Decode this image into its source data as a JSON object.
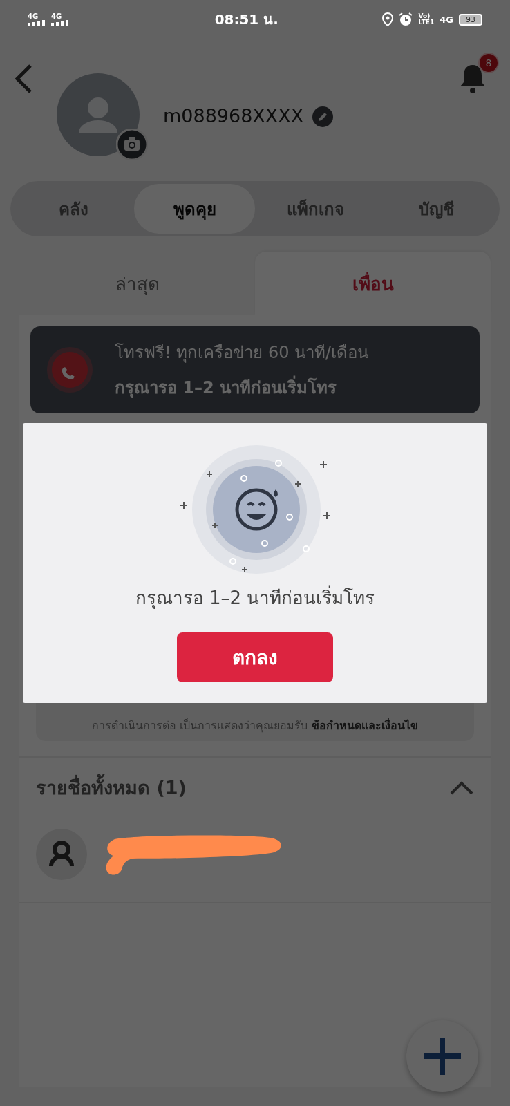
{
  "status_bar": {
    "signals": [
      "4G",
      "4G"
    ],
    "time": "08:51 น.",
    "volte": [
      "Vo)",
      "LTE1"
    ],
    "network": "4G",
    "battery": "93"
  },
  "header": {
    "username": "m088968XXXX",
    "notification_count": "8"
  },
  "tabs": [
    {
      "label": "คลัง",
      "selected": false
    },
    {
      "label": "พูดคุย",
      "selected": true
    },
    {
      "label": "แพ็กเกจ",
      "selected": false
    },
    {
      "label": "บัญชี",
      "selected": false
    }
  ],
  "subtabs": [
    {
      "label": "ล่าสุด",
      "selected": false
    },
    {
      "label": "เพื่อน",
      "selected": true
    }
  ],
  "banner": {
    "title": "โทรฟรี! ทุกเครือข่าย 60 นาที/เดือน",
    "subtitle": "กรุณารอ 1–2 นาทีก่อนเริ่มโทร"
  },
  "terms": {
    "text": "การดำเนินการต่อ เป็นการแสดงว่าคุณยอมรับ",
    "link": "ข้อกำหนดและเงื่อนไข"
  },
  "contacts_section": {
    "title": "รายชื่อทั้งหมด (1)",
    "expanded": true,
    "contacts": [
      {
        "name_redacted": true
      }
    ]
  },
  "dialog": {
    "message": "กรุณารอ 1–2 นาทีก่อนเริ่มโทร",
    "button": "ตกลง"
  }
}
